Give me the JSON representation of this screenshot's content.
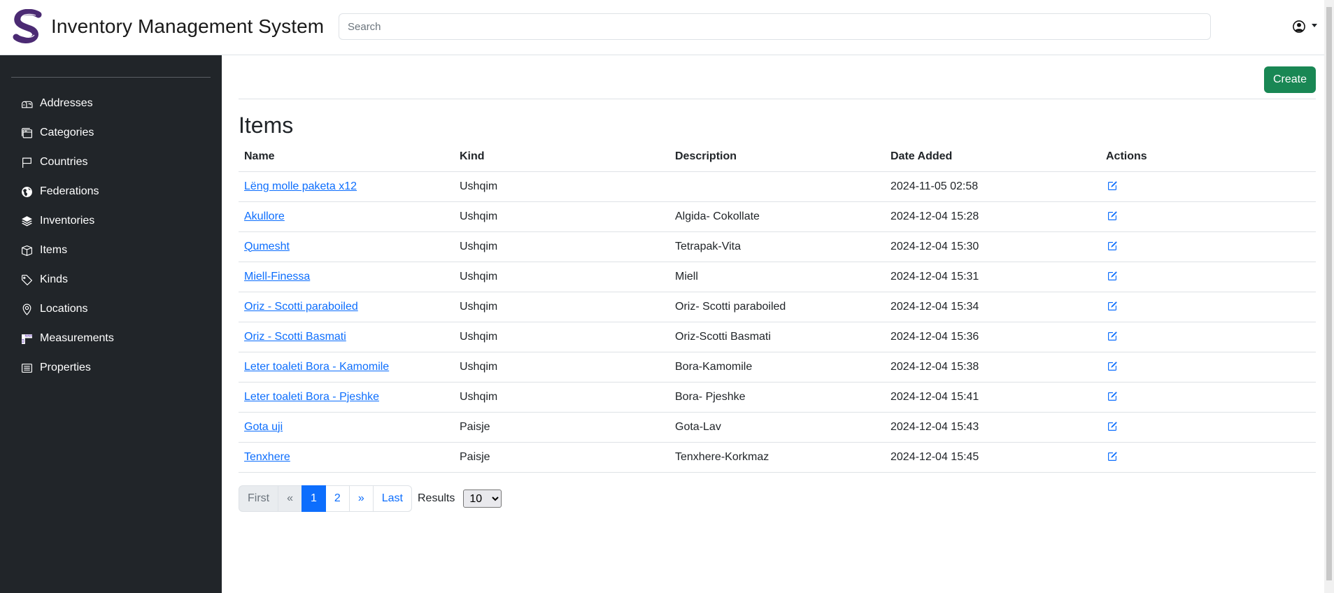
{
  "app": {
    "title": "Inventory Management System",
    "brand_color": "#4b2a73"
  },
  "header": {
    "search_placeholder": "Search",
    "search_value": "",
    "user_icon": "person-circle-icon"
  },
  "sidebar": {
    "items": [
      {
        "label": "Addresses",
        "icon": "mailbox-icon"
      },
      {
        "label": "Categories",
        "icon": "window-stack-icon"
      },
      {
        "label": "Countries",
        "icon": "flag-icon"
      },
      {
        "label": "Federations",
        "icon": "globe-icon"
      },
      {
        "label": "Inventories",
        "icon": "layers-icon"
      },
      {
        "label": "Items",
        "icon": "box-icon"
      },
      {
        "label": "Kinds",
        "icon": "tag-icon"
      },
      {
        "label": "Locations",
        "icon": "geo-pin-icon"
      },
      {
        "label": "Measurements",
        "icon": "ruler-icon"
      },
      {
        "label": "Properties",
        "icon": "list-card-icon"
      }
    ]
  },
  "main": {
    "create_label": "Create",
    "page_title": "Items",
    "table": {
      "columns": [
        "Name",
        "Kind",
        "Description",
        "Date Added",
        "Actions"
      ],
      "rows": [
        {
          "name": "Lëng molle paketa x12",
          "kind": "Ushqim",
          "description": "",
          "date_added": "2024-11-05 02:58"
        },
        {
          "name": "Akullore",
          "kind": "Ushqim",
          "description": "Algida- Cokollate",
          "date_added": "2024-12-04 15:28"
        },
        {
          "name": "Qumesht",
          "kind": "Ushqim",
          "description": "Tetrapak-Vita",
          "date_added": "2024-12-04 15:30"
        },
        {
          "name": "Miell-Finessa",
          "kind": "Ushqim",
          "description": "Miell",
          "date_added": "2024-12-04 15:31"
        },
        {
          "name": "Oriz - Scotti paraboiled",
          "kind": "Ushqim",
          "description": "Oriz- Scotti paraboiled",
          "date_added": "2024-12-04 15:34"
        },
        {
          "name": "Oriz - Scotti Basmati",
          "kind": "Ushqim",
          "description": "Oriz-Scotti Basmati",
          "date_added": "2024-12-04 15:36"
        },
        {
          "name": "Leter toaleti Bora - Kamomile",
          "kind": "Ushqim",
          "description": "Bora-Kamomile",
          "date_added": "2024-12-04 15:38"
        },
        {
          "name": "Leter toaleti Bora - Pjeshke",
          "kind": "Ushqim",
          "description": "Bora- Pjeshke",
          "date_added": "2024-12-04 15:41"
        },
        {
          "name": "Gota uji",
          "kind": "Paisje",
          "description": "Gota-Lav",
          "date_added": "2024-12-04 15:43"
        },
        {
          "name": "Tenxhere",
          "kind": "Paisje",
          "description": "Tenxhere-Korkmaz",
          "date_added": "2024-12-04 15:45"
        }
      ]
    },
    "pagination": {
      "first": "First",
      "prev": "«",
      "pages": [
        "1",
        "2"
      ],
      "current_page": "1",
      "next": "»",
      "last": "Last",
      "results_label": "Results",
      "results_value": "10"
    }
  },
  "colors": {
    "sidebar_bg": "#212529",
    "link": "#0d6efd",
    "create_button": "#198754",
    "active_page": "#0d6efd"
  }
}
